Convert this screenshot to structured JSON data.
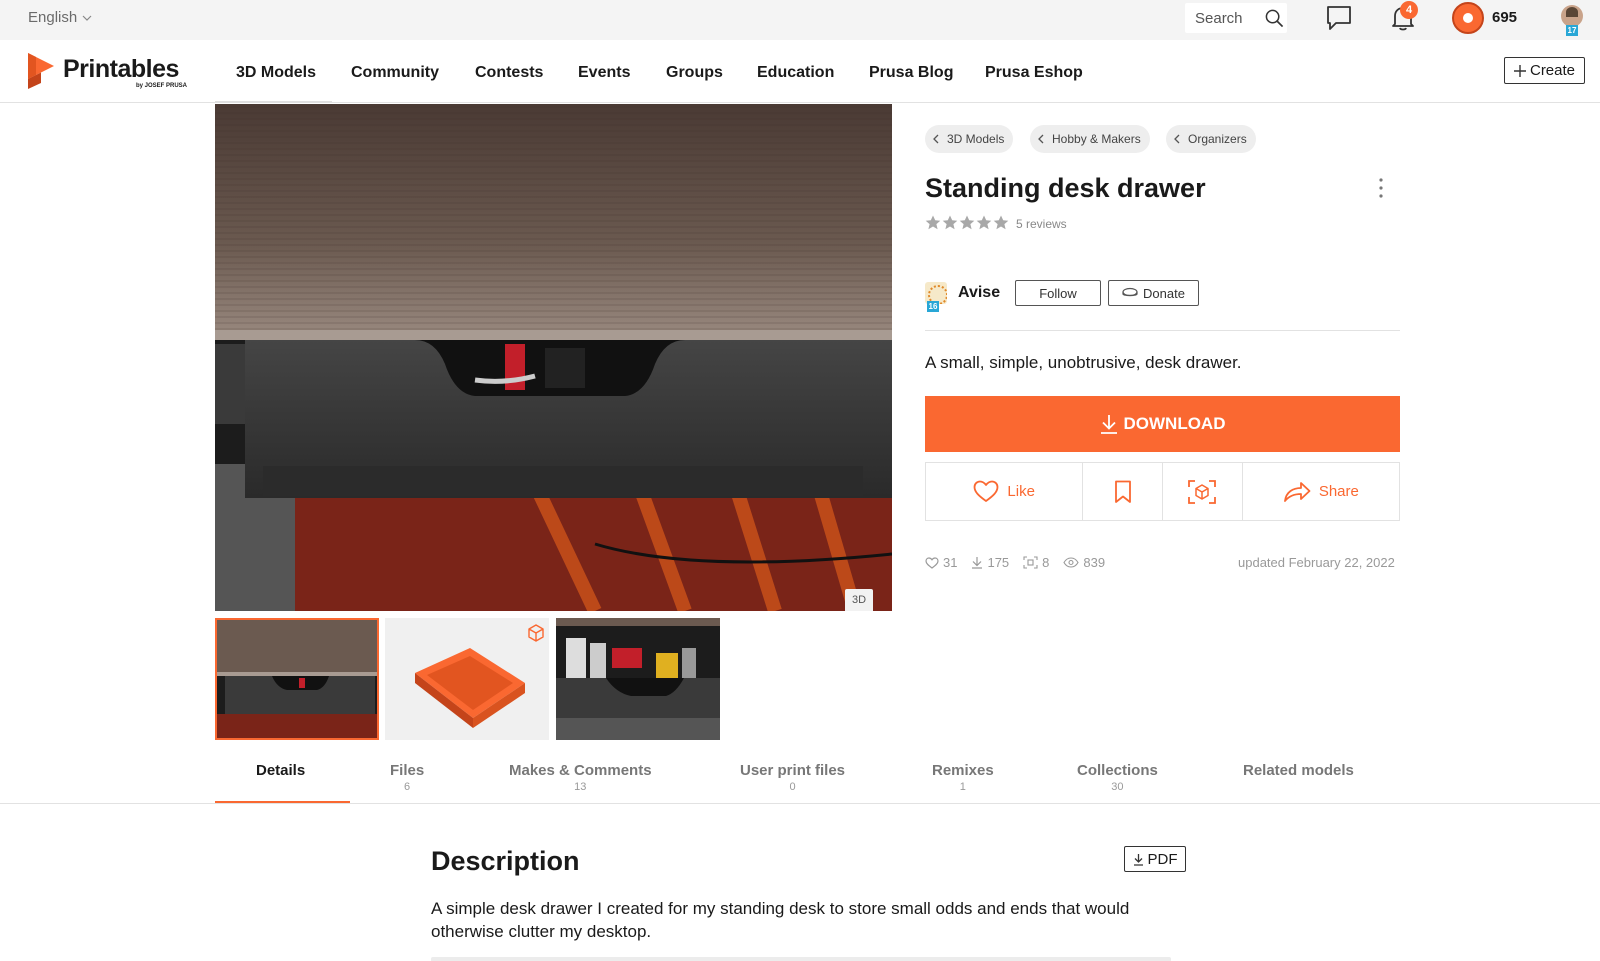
{
  "topbar": {
    "language": "English",
    "search_placeholder": "Search",
    "notifications_count": "4",
    "spools_count": "695",
    "user_level": "17"
  },
  "nav": {
    "logo": "Printables",
    "logo_sub": "by JOSEF PRUSA",
    "items": [
      "3D Models",
      "Community",
      "Contests",
      "Events",
      "Groups",
      "Education",
      "Prusa Blog",
      "Prusa Eshop"
    ],
    "create": "Create"
  },
  "gallery": {
    "badge": "3D"
  },
  "model": {
    "breadcrumbs": [
      "3D Models",
      "Hobby & Makers",
      "Organizers"
    ],
    "title": "Standing desk drawer",
    "rating": 5,
    "reviews": "5 reviews",
    "author": "Avise",
    "author_level": "16",
    "follow": "Follow",
    "donate": "Donate",
    "summary": "A small, simple, unobtrusive, desk drawer.",
    "download": "DOWNLOAD",
    "like": "Like",
    "share": "Share",
    "stats": {
      "likes": "31",
      "downloads": "175",
      "prints": "8",
      "views": "839"
    },
    "updated": "updated February 22, 2022"
  },
  "tabs": [
    {
      "label": "Details",
      "count": ""
    },
    {
      "label": "Files",
      "count": "6"
    },
    {
      "label": "Makes & Comments",
      "count": "13"
    },
    {
      "label": "User print files",
      "count": "0"
    },
    {
      "label": "Remixes",
      "count": "1"
    },
    {
      "label": "Collections",
      "count": "30"
    },
    {
      "label": "Related models",
      "count": ""
    }
  ],
  "description": {
    "title": "Description",
    "pdf": "PDF",
    "text": "A simple desk drawer I created for my standing desk to store small odds and ends that would otherwise clutter my desktop."
  },
  "colors": {
    "accent": "#fa6831",
    "text": "#1a1a1a",
    "muted": "#999999",
    "topbar_bg": "#f4f4f4"
  }
}
